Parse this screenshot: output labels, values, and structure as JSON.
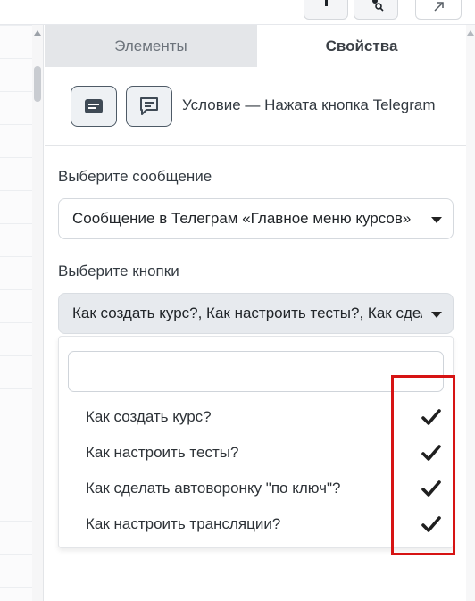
{
  "tabs": [
    {
      "label": "Элементы",
      "active": false
    },
    {
      "label": "Свойства",
      "active": true
    }
  ],
  "condition": {
    "text": "Условие — Нажата кнопка Telegram"
  },
  "message_select": {
    "label": "Выберите сообщение",
    "value": "Сообщение в Телеграм «Главное меню курсов»"
  },
  "buttons_select": {
    "label": "Выберите кнопки",
    "value": "Как создать курс?, Как настроить тесты?, Как сделать автоворонку \"по ключ\"?, Как настроить трансляции?",
    "search_value": "",
    "options": [
      {
        "label": "Как создать курс?",
        "selected": true
      },
      {
        "label": "Как настроить тесты?",
        "selected": true
      },
      {
        "label": "Как сделать автоворонку \"по ключ\"?",
        "selected": true
      },
      {
        "label": "Как настроить трансляции?",
        "selected": true
      }
    ]
  },
  "icons": {
    "toolbar": [
      "pin-icon",
      "user-search-icon",
      "expand-arrow-icon"
    ],
    "message_row": [
      "message-icon",
      "chat-icon"
    ],
    "option_marker": "checkmark-icon"
  },
  "colors": {
    "highlight": "#d61313",
    "active_tab_bg": "#ffffff",
    "inactive_tab_bg": "#e4e6e9",
    "selected_field_bg": "#e7eaee"
  }
}
